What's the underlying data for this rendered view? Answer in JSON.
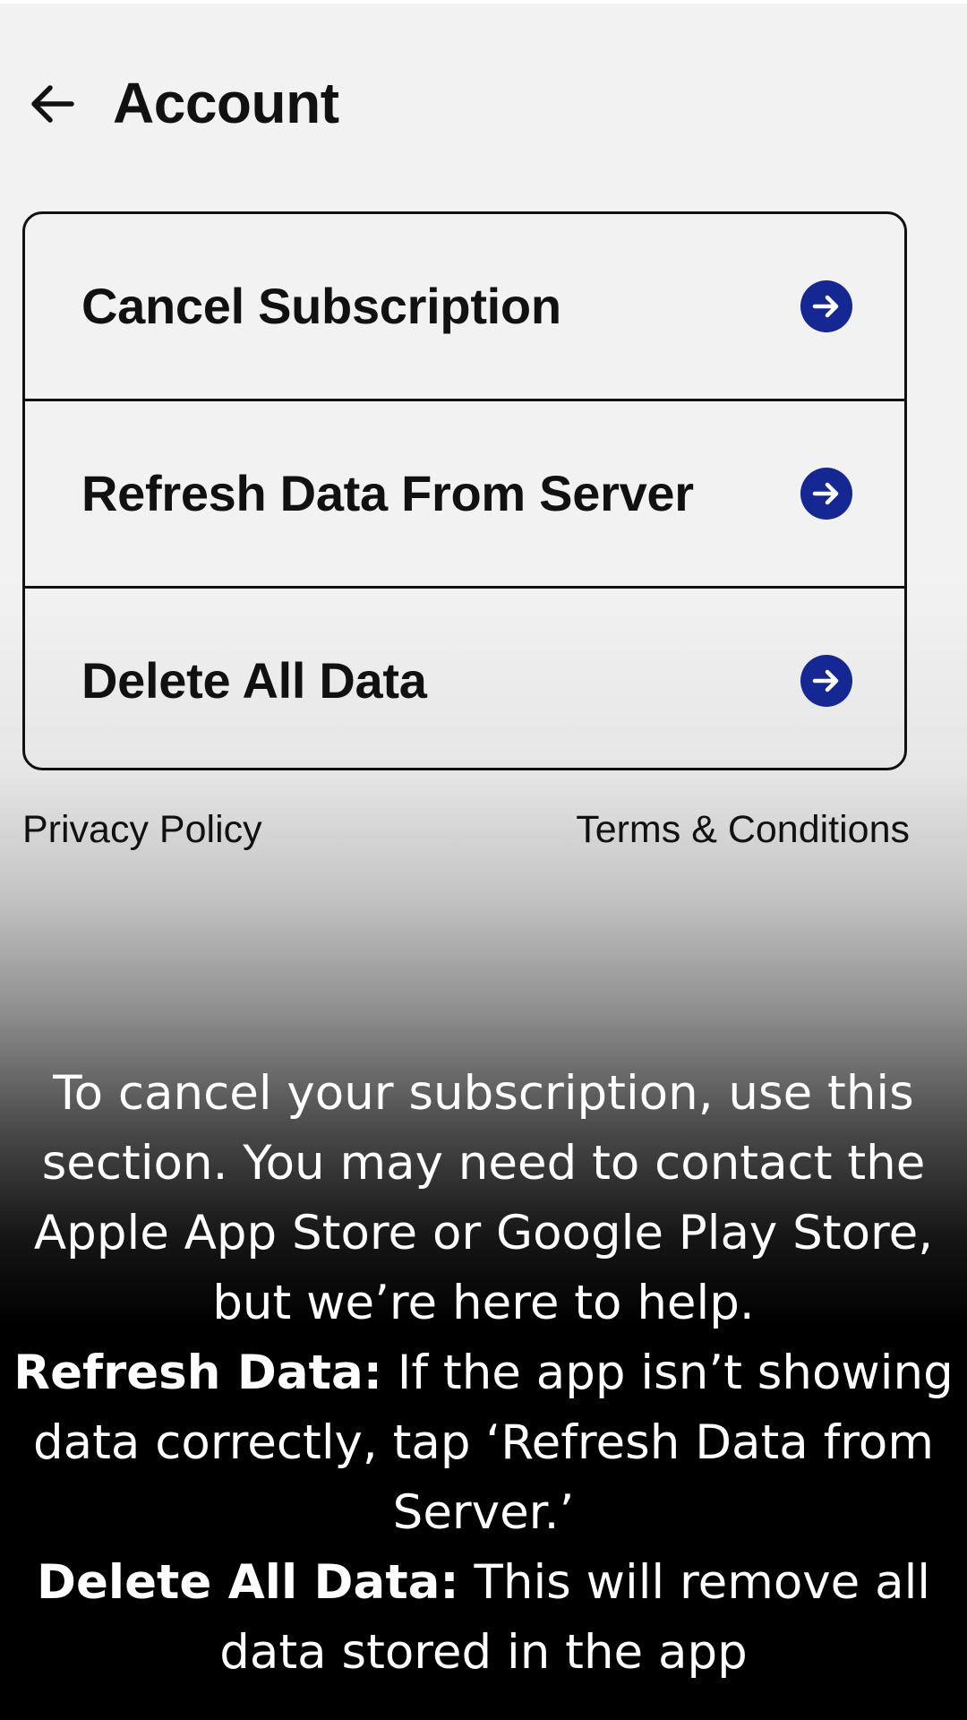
{
  "header": {
    "title": "Account",
    "back_icon": "arrow-left-icon"
  },
  "menu": {
    "items": [
      {
        "label": "Cancel Subscription",
        "icon": "arrow-right-circle-icon"
      },
      {
        "label": "Refresh Data From Server",
        "icon": "arrow-right-circle-icon"
      },
      {
        "label": "Delete All Data",
        "icon": "arrow-right-circle-icon"
      }
    ],
    "accent_color": "#142792"
  },
  "footer": {
    "privacy_label": "Privacy Policy",
    "terms_label": "Terms & Conditions"
  },
  "help": {
    "intro": "To cancel your subscription, use this section. You may need to contact the Apple App Store or Google Play Store, but we’re here to help.",
    "refresh_title": "Refresh Data:",
    "refresh_text": " If the app isn’t showing data correctly, tap ‘Refresh Data from Server.’",
    "delete_title": "Delete All Data:",
    "delete_text": " This will remove all data stored in the app"
  }
}
